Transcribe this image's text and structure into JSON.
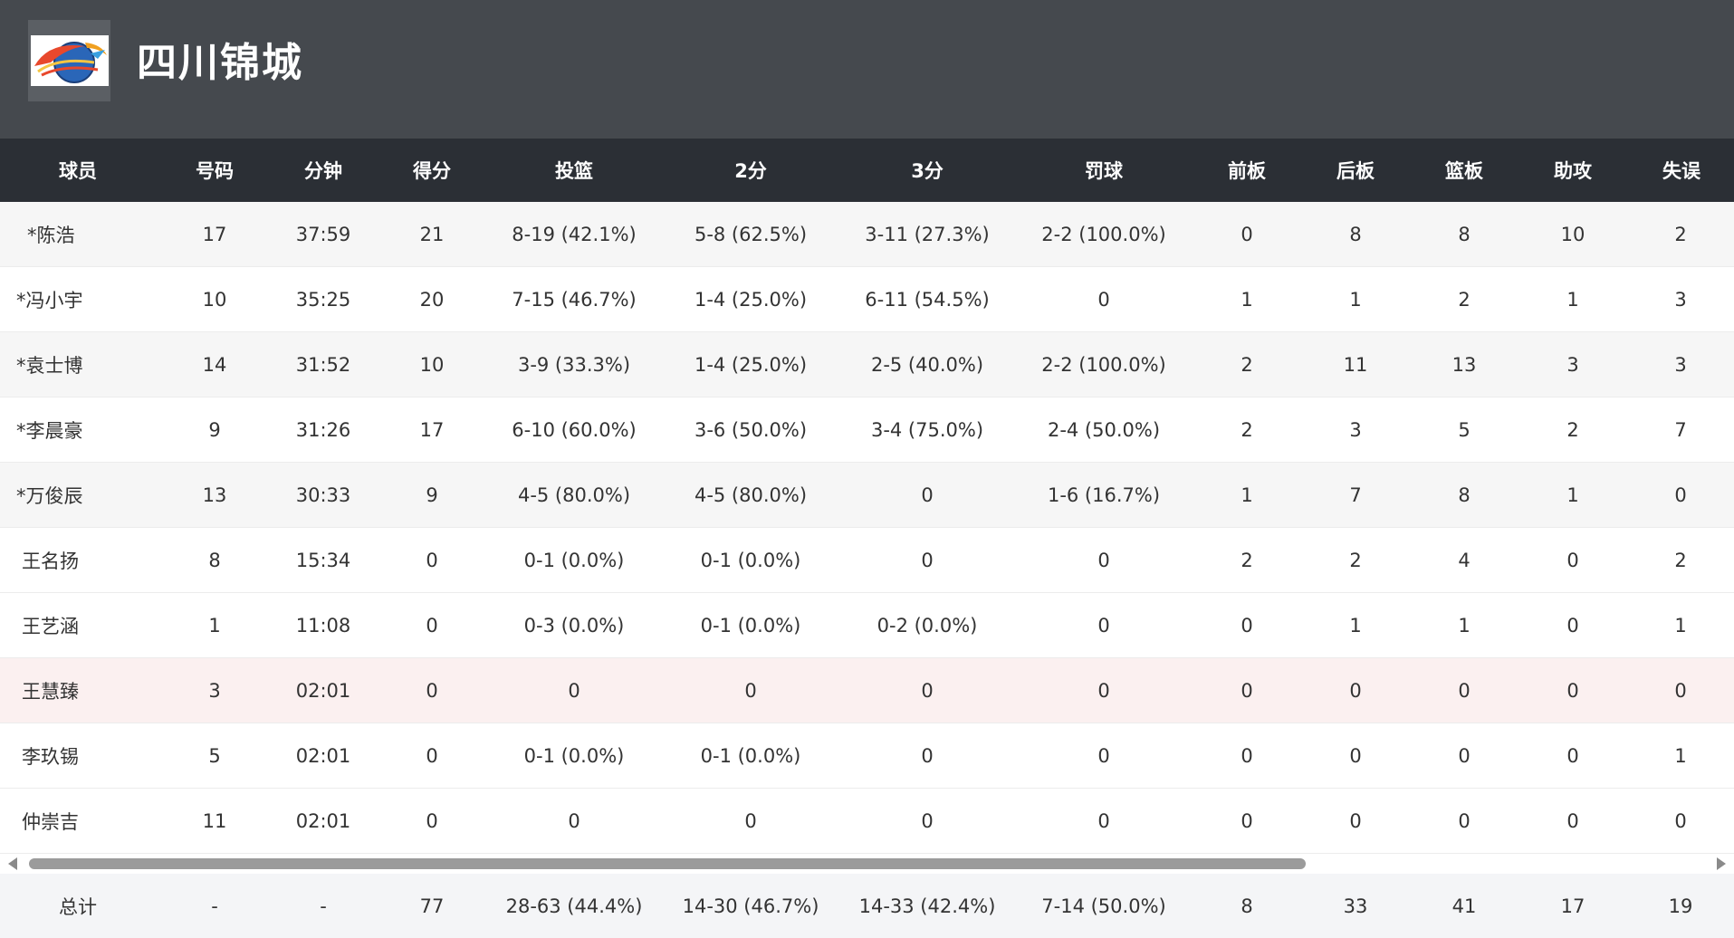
{
  "team": {
    "name": "四川锦城",
    "logo_icon": "team-logo-icon"
  },
  "columns": [
    "球员",
    "号码",
    "分钟",
    "得分",
    "投篮",
    "2分",
    "3分",
    "罚球",
    "前板",
    "后板",
    "篮板",
    "助攻",
    "失误"
  ],
  "players": [
    [
      "*陈浩",
      "17",
      "37:59",
      "21",
      "8-19 (42.1%)",
      "5-8 (62.5%)",
      "3-11 (27.3%)",
      "2-2 (100.0%)",
      "0",
      "8",
      "8",
      "10",
      "2"
    ],
    [
      "*冯小宇",
      "10",
      "35:25",
      "20",
      "7-15 (46.7%)",
      "1-4 (25.0%)",
      "6-11 (54.5%)",
      "0",
      "1",
      "1",
      "2",
      "1",
      "3"
    ],
    [
      "*袁士博",
      "14",
      "31:52",
      "10",
      "3-9 (33.3%)",
      "1-4 (25.0%)",
      "2-5 (40.0%)",
      "2-2 (100.0%)",
      "2",
      "11",
      "13",
      "3",
      "3"
    ],
    [
      "*李晨豪",
      "9",
      "31:26",
      "17",
      "6-10 (60.0%)",
      "3-6 (50.0%)",
      "3-4 (75.0%)",
      "2-4 (50.0%)",
      "2",
      "3",
      "5",
      "2",
      "7"
    ],
    [
      "*万俊辰",
      "13",
      "30:33",
      "9",
      "4-5 (80.0%)",
      "4-5 (80.0%)",
      "0",
      "1-6 (16.7%)",
      "1",
      "7",
      "8",
      "1",
      "0"
    ],
    [
      "王名扬",
      "8",
      "15:34",
      "0",
      "0-1 (0.0%)",
      "0-1 (0.0%)",
      "0",
      "0",
      "2",
      "2",
      "4",
      "0",
      "2"
    ],
    [
      "王艺涵",
      "1",
      "11:08",
      "0",
      "0-3 (0.0%)",
      "0-1 (0.0%)",
      "0-2 (0.0%)",
      "0",
      "0",
      "1",
      "1",
      "0",
      "1"
    ],
    [
      "王慧臻",
      "3",
      "02:01",
      "0",
      "0",
      "0",
      "0",
      "0",
      "0",
      "0",
      "0",
      "0",
      "0"
    ],
    [
      "李玖锡",
      "5",
      "02:01",
      "0",
      "0-1 (0.0%)",
      "0-1 (0.0%)",
      "0",
      "0",
      "0",
      "0",
      "0",
      "0",
      "1"
    ],
    [
      "仲崇吉",
      "11",
      "02:01",
      "0",
      "0",
      "0",
      "0",
      "0",
      "0",
      "0",
      "0",
      "0",
      "0"
    ]
  ],
  "totals": [
    "总计",
    "-",
    "-",
    "77",
    "28-63 (44.4%)",
    "14-30 (46.7%)",
    "14-33 (42.4%)",
    "7-14 (50.0%)",
    "8",
    "33",
    "41",
    "17",
    "19"
  ],
  "colors": {
    "header_bg": "#45494e",
    "column_header_bg": "#2b2f35",
    "row_stripe": "#f6f6f6",
    "row_highlight": "#fbf0f0"
  }
}
